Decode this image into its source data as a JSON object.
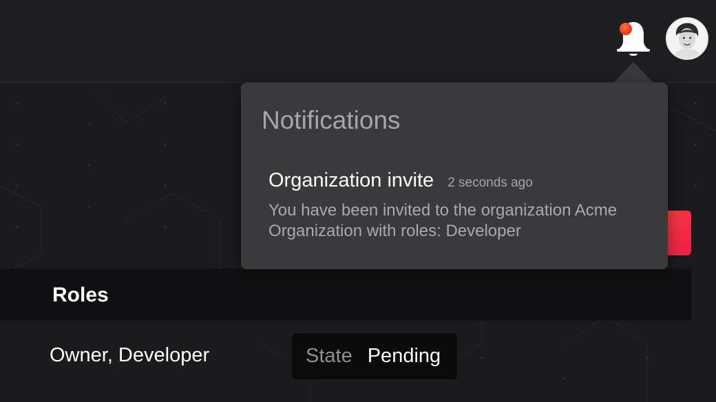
{
  "topbar": {
    "bell_icon": "bell-icon",
    "has_unread": true,
    "accent": "#f03a18",
    "avatar_alt": "user avatar"
  },
  "notifications": {
    "title": "Notifications",
    "items": [
      {
        "title": "Organization invite",
        "time": "2 seconds ago",
        "body": "You have been invited to the organization Acme Organization with roles: Developer"
      }
    ]
  },
  "table": {
    "roles_header": "Roles",
    "roles_value": "Owner, Developer",
    "state_label": "State",
    "state_value": "Pending"
  },
  "colors": {
    "background": "#1b1b1e",
    "popover": "#3a3a3d",
    "button_gradient": [
      "#ff4a3a",
      "#f01b4a"
    ]
  }
}
